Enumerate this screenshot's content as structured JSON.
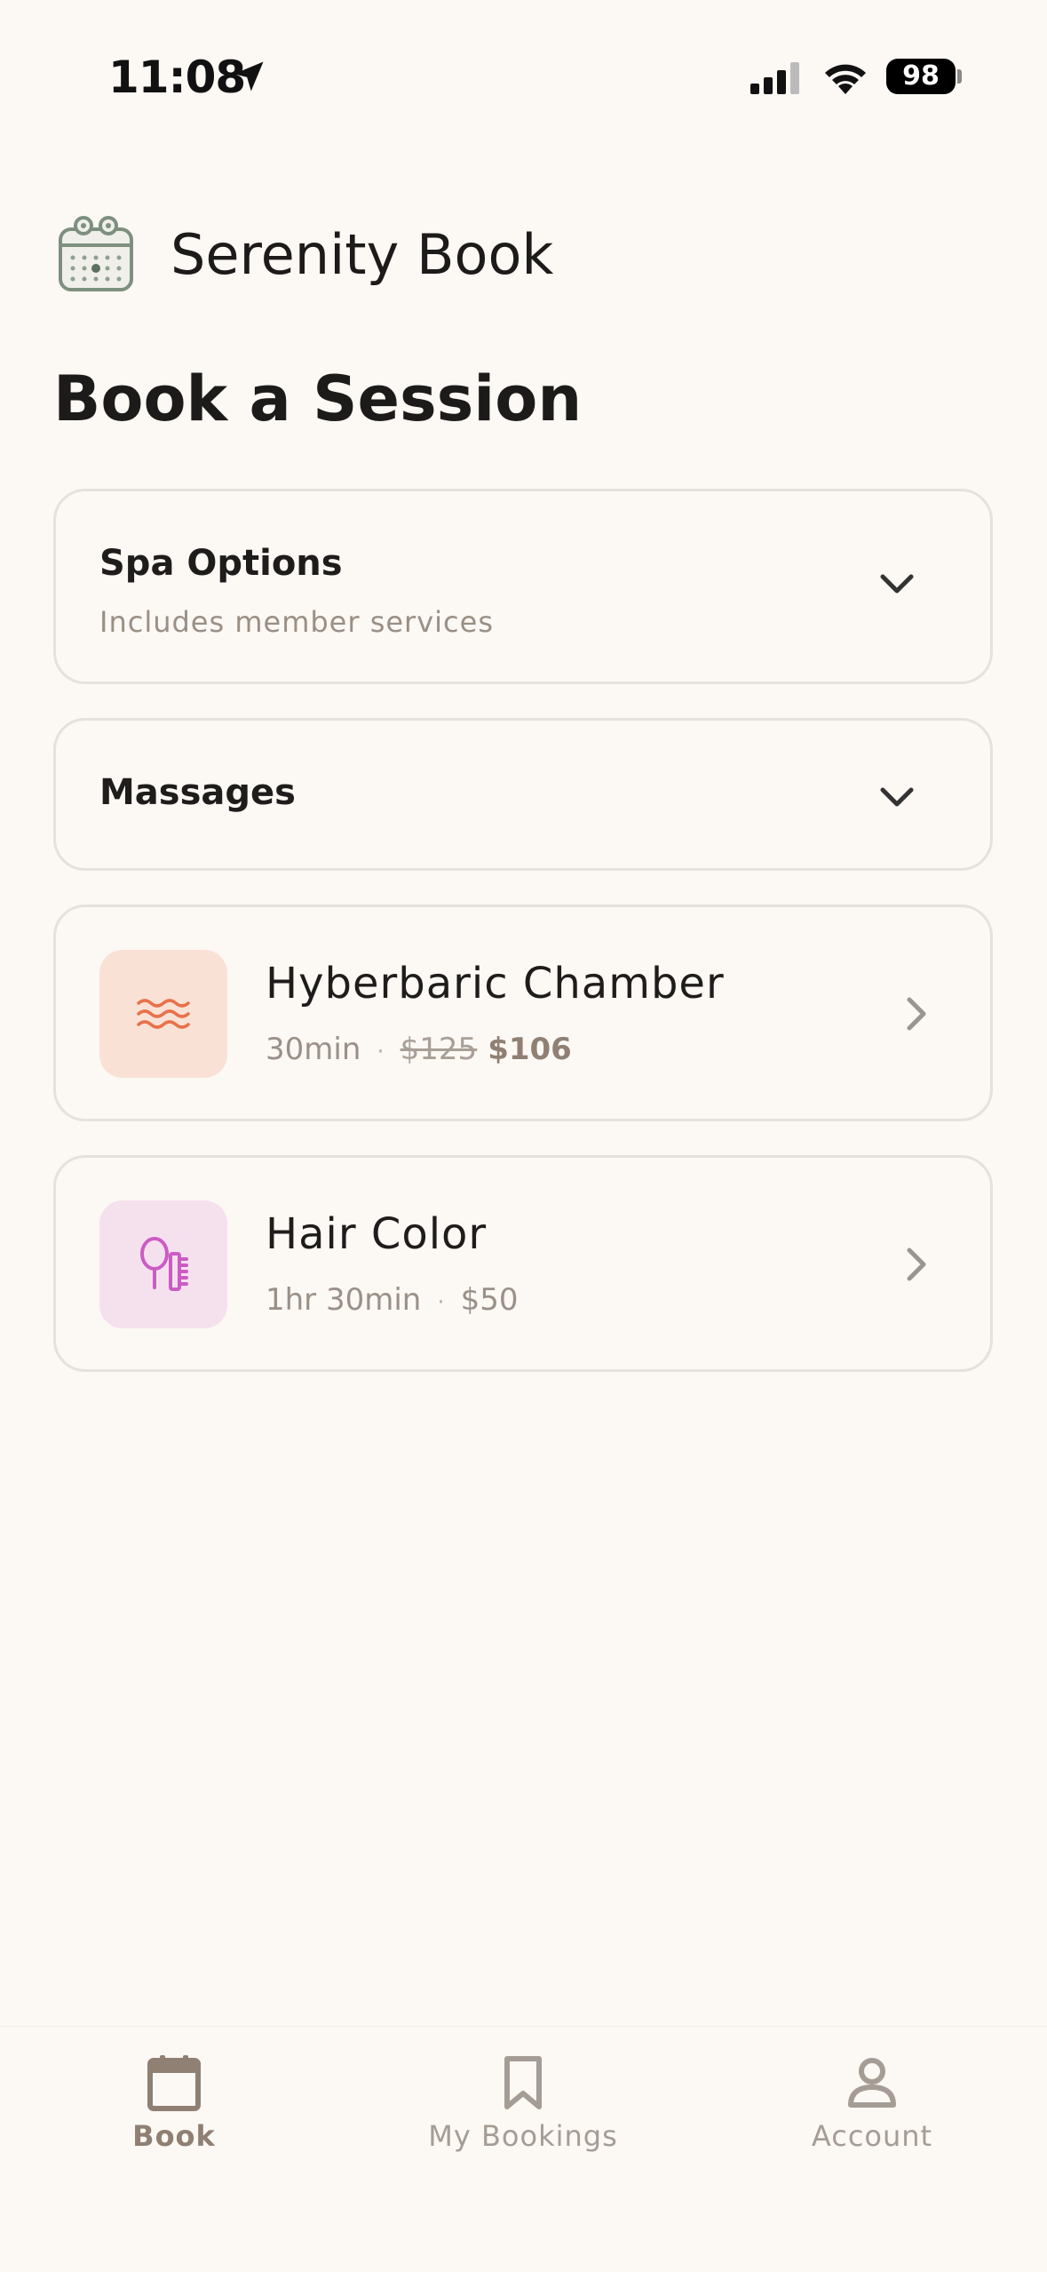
{
  "status_bar": {
    "time": "11:08",
    "battery": "98"
  },
  "brand": {
    "name": "Serenity Book"
  },
  "page": {
    "title": "Book a Session"
  },
  "sections": [
    {
      "title": "Spa Options",
      "subtitle": "Includes member services"
    },
    {
      "title": "Massages"
    }
  ],
  "services": [
    {
      "name": "Hyberbaric Chamber",
      "duration": "30min",
      "original_price": "$125",
      "price": "$106",
      "icon": "waves-icon",
      "tint": "#fae1d5",
      "icon_color": "#e8714a"
    },
    {
      "name": "Hair Color",
      "duration": "1hr 30min",
      "price": "$50",
      "icon": "mirror-comb-icon",
      "tint": "#f5e1ee",
      "icon_color": "#cc5bc4"
    }
  ],
  "tabs": [
    {
      "label": "Book",
      "icon": "calendar-icon",
      "active": true
    },
    {
      "label": "My Bookings",
      "icon": "bookmark-icon",
      "active": false
    },
    {
      "label": "Account",
      "icon": "person-icon",
      "active": false
    }
  ]
}
